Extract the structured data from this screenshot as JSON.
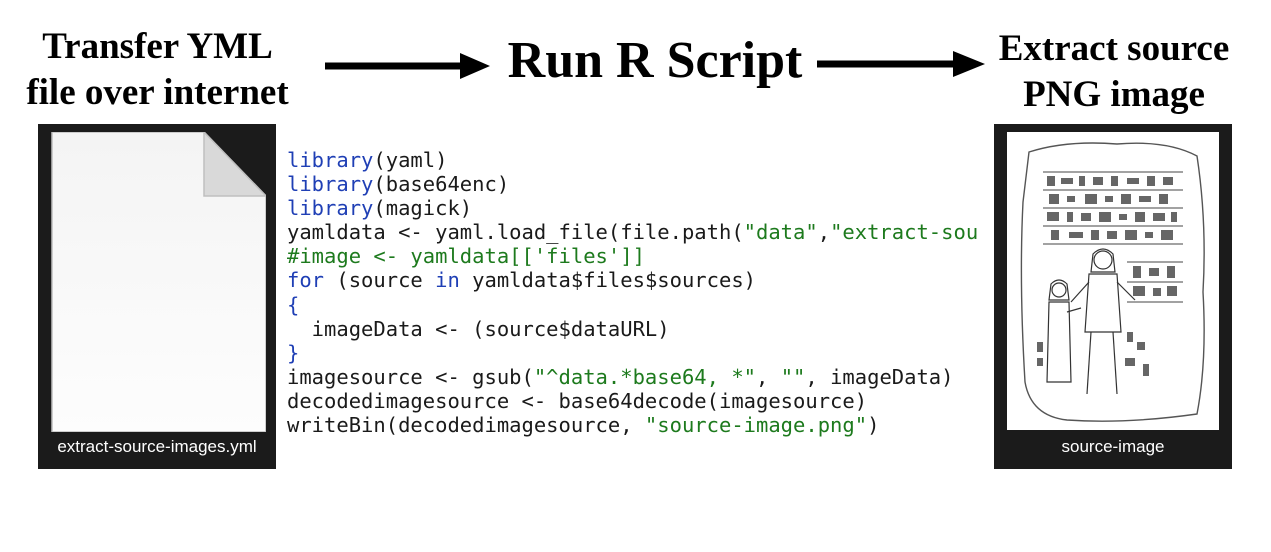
{
  "headings": {
    "left": [
      "Transfer YML",
      "file over internet"
    ],
    "middle": "Run R Script",
    "right": [
      "Extract source",
      "PNG image"
    ]
  },
  "file_tile": {
    "caption": "extract-source-images.yml"
  },
  "image_tile": {
    "caption": "source-image"
  },
  "code_lines": [
    [
      {
        "t": "library",
        "c": "kw"
      },
      {
        "t": "(yaml)",
        "c": "pl"
      }
    ],
    [
      {
        "t": "library",
        "c": "kw"
      },
      {
        "t": "(base64enc)",
        "c": "pl"
      }
    ],
    [
      {
        "t": "library",
        "c": "kw"
      },
      {
        "t": "(magick)",
        "c": "pl"
      }
    ],
    [
      {
        "t": "yamldata <- yaml.load_file(file.path(",
        "c": "pl"
      },
      {
        "t": "\"data\"",
        "c": "str"
      },
      {
        "t": ",",
        "c": "pl"
      },
      {
        "t": "\"extract-sou",
        "c": "str"
      }
    ],
    [
      {
        "t": "#image <- yamldata[['files']]",
        "c": "cm"
      }
    ],
    [
      {
        "t": "for",
        "c": "kw"
      },
      {
        "t": " (source ",
        "c": "pl"
      },
      {
        "t": "in",
        "c": "kw"
      },
      {
        "t": " yamldata$files$sources)",
        "c": "pl"
      }
    ],
    [
      {
        "t": "{",
        "c": "kw"
      }
    ],
    [
      {
        "t": "  imageData <- (source$dataURL)",
        "c": "pl"
      }
    ],
    [
      {
        "t": "}",
        "c": "kw"
      }
    ],
    [
      {
        "t": "imagesource <- gsub(",
        "c": "pl"
      },
      {
        "t": "\"^data.*base64, *\"",
        "c": "str"
      },
      {
        "t": ", ",
        "c": "pl"
      },
      {
        "t": "\"\"",
        "c": "str"
      },
      {
        "t": ", imageData)",
        "c": "pl"
      }
    ],
    [
      {
        "t": "decodedimagesource <- base64decode(imagesource)",
        "c": "pl"
      }
    ],
    [
      {
        "t": "writeBin(decodedimagesource, ",
        "c": "pl"
      },
      {
        "t": "\"source-image.png\"",
        "c": "str"
      },
      {
        "t": ")",
        "c": "pl"
      }
    ]
  ],
  "colors": {
    "keyword": "#1f3fb5",
    "string": "#1d7a1d",
    "tile_background": "#1b1b1b"
  }
}
